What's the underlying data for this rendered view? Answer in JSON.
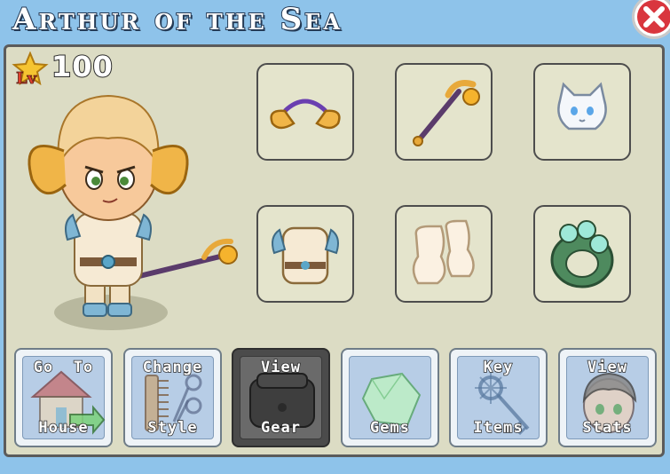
{
  "window": {
    "title": "Arthur of the Sea"
  },
  "level": {
    "badge": "Lv",
    "value": "100"
  },
  "equipment_slots": [
    {
      "item": "ram-horns-headband"
    },
    {
      "item": "golden-staff"
    },
    {
      "item": "white-cat-pet"
    },
    {
      "item": "ram-armor"
    },
    {
      "item": "fluffy-boots"
    },
    {
      "item": "jade-ring"
    }
  ],
  "actions": [
    {
      "line1": "Go  To",
      "line2": "House"
    },
    {
      "line1": "Change",
      "line2": "Style"
    },
    {
      "line1": "View",
      "line2": "Gear",
      "active": true
    },
    {
      "line1": "",
      "line2": "Gems"
    },
    {
      "line1": "Key",
      "line2": "Items"
    },
    {
      "line1": "View",
      "line2": "Stats"
    }
  ],
  "colors": {
    "background": "#8ec3ea",
    "panel": "#dcdcc4",
    "button_active": "#4b4b4b",
    "close": "#d9363e"
  }
}
